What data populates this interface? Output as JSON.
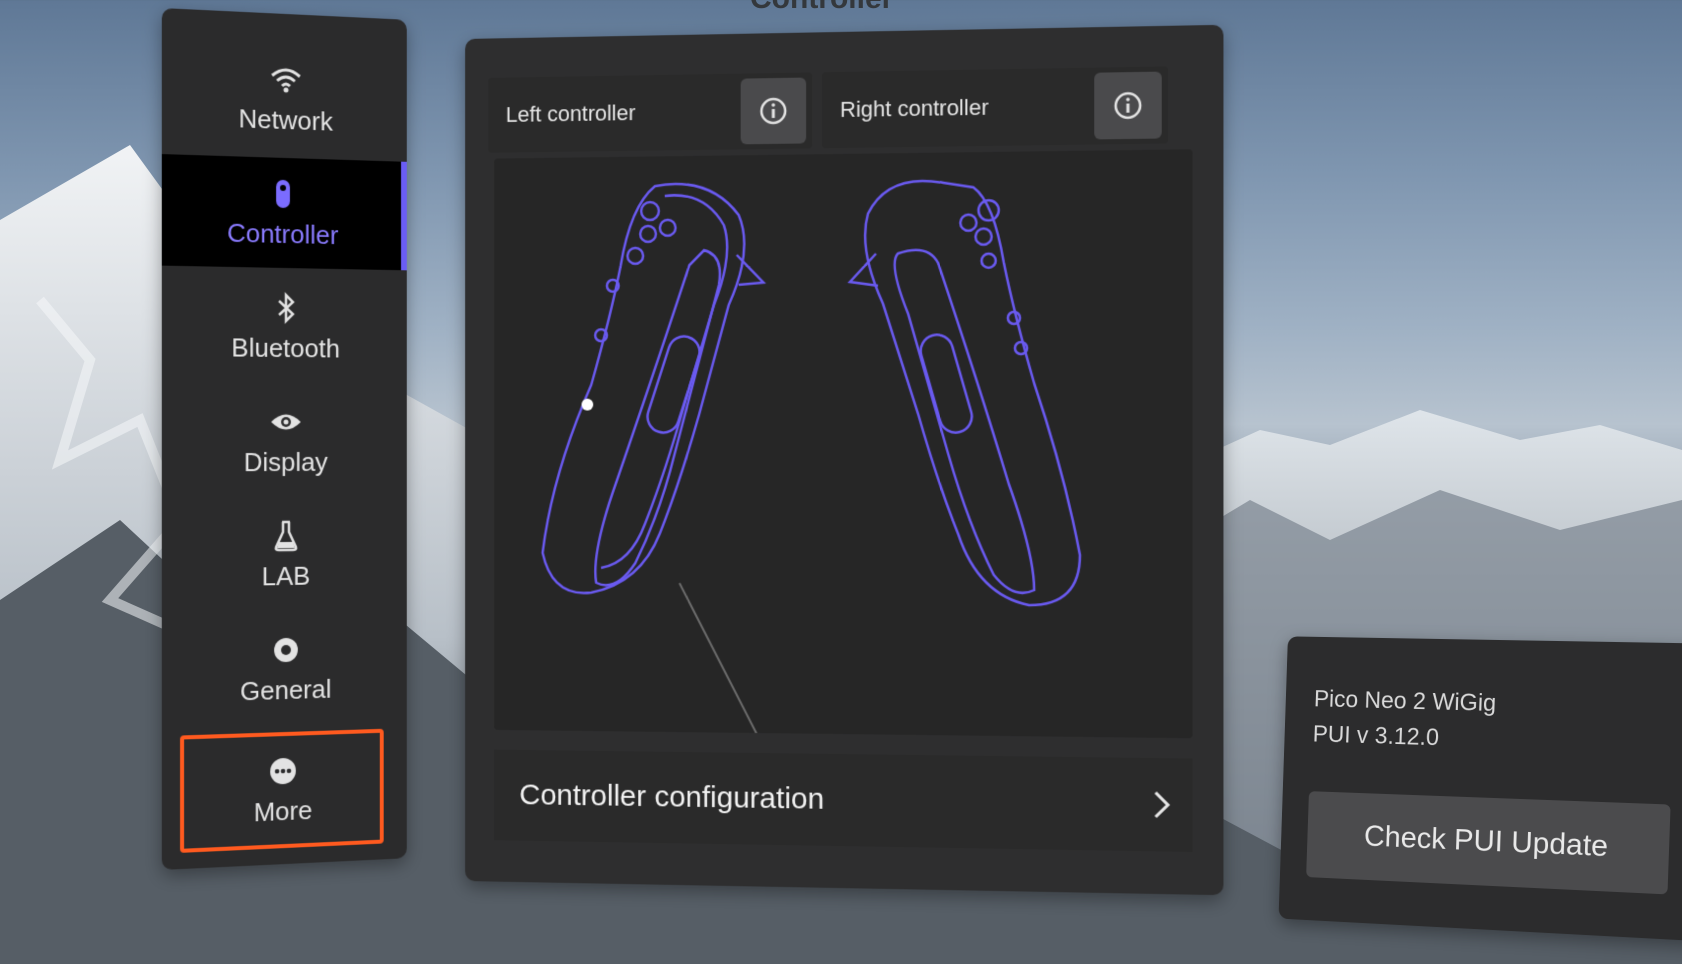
{
  "top_title": "Controller",
  "sidebar": {
    "items": [
      {
        "label": "Network",
        "icon": "wifi-icon"
      },
      {
        "label": "Controller",
        "icon": "controller-icon",
        "active": true
      },
      {
        "label": "Bluetooth",
        "icon": "bluetooth-icon"
      },
      {
        "label": "Display",
        "icon": "eye-icon"
      },
      {
        "label": "LAB",
        "icon": "flask-icon"
      },
      {
        "label": "General",
        "icon": "gear-icon"
      },
      {
        "label": "More",
        "icon": "more-icon",
        "highlighted": true
      }
    ]
  },
  "main": {
    "left_controller_label": "Left controller",
    "right_controller_label": "Right controller",
    "config_label": "Controller configuration"
  },
  "device": {
    "name": "Pico Neo 2 WiGig",
    "version": "PUI v 3.12.0",
    "update_button": "Check PUI Update"
  },
  "colors": {
    "accent": "#6a5df5",
    "highlight": "#ff5a1f",
    "panel": "#2e2e2f"
  }
}
